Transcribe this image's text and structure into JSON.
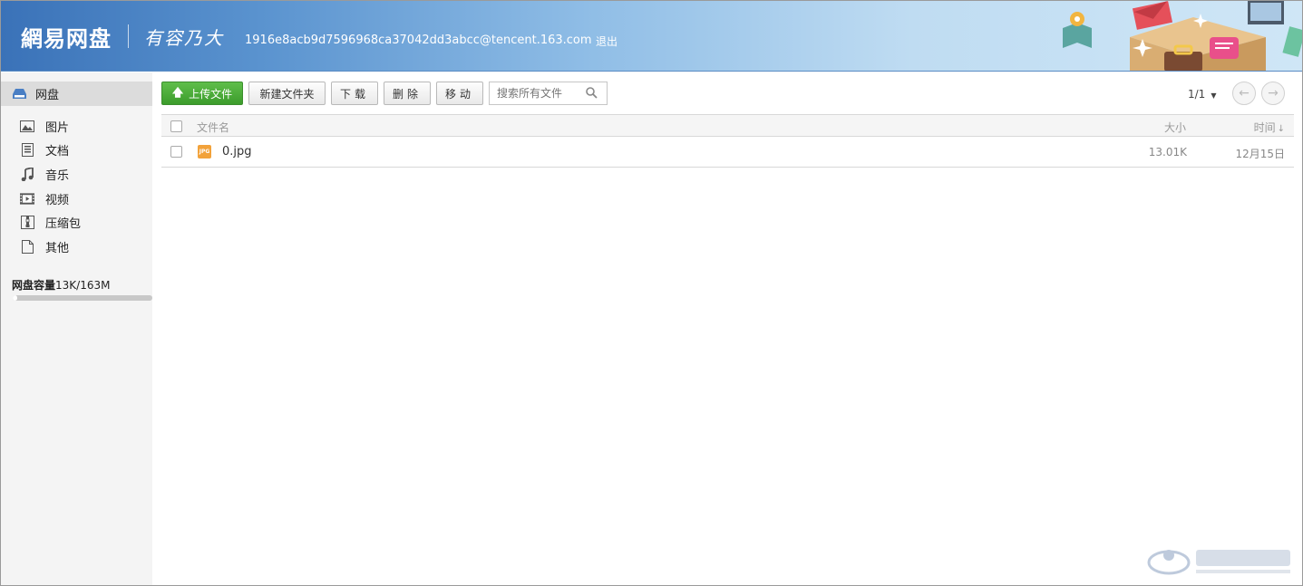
{
  "header": {
    "logo": "網易网盘",
    "slogan": "有容乃大",
    "account": "1916e8acb9d7596968ca37042dd3abcc@tencent.163.com",
    "logout": "退出"
  },
  "sidebar": {
    "root_label": "网盘",
    "items": [
      {
        "label": "图片",
        "icon": "image-icon"
      },
      {
        "label": "文档",
        "icon": "document-icon"
      },
      {
        "label": "音乐",
        "icon": "music-icon"
      },
      {
        "label": "视频",
        "icon": "video-icon"
      },
      {
        "label": "压缩包",
        "icon": "archive-icon"
      },
      {
        "label": "其他",
        "icon": "file-icon"
      }
    ],
    "quota_label": "网盘容量",
    "quota_value": "13K/163M",
    "quota_used_fraction": 0.0001
  },
  "toolbar": {
    "upload_label": "上传文件",
    "newfolder_label": "新建文件夹",
    "download_label": "下载",
    "delete_label": "删除",
    "move_label": "移动",
    "search_placeholder": "搜索所有文件"
  },
  "pager": {
    "label": "1/1"
  },
  "table": {
    "headers": {
      "name": "文件名",
      "size": "大小",
      "time": "时间"
    },
    "rows": [
      {
        "name": "0.jpg",
        "type": "JPG",
        "size": "13.01K",
        "time": "12月15日"
      }
    ]
  },
  "colors": {
    "upload_green": "#4aa93a",
    "header_blue": "#3a72b8",
    "sidebar_bg": "#f4f4f4"
  }
}
